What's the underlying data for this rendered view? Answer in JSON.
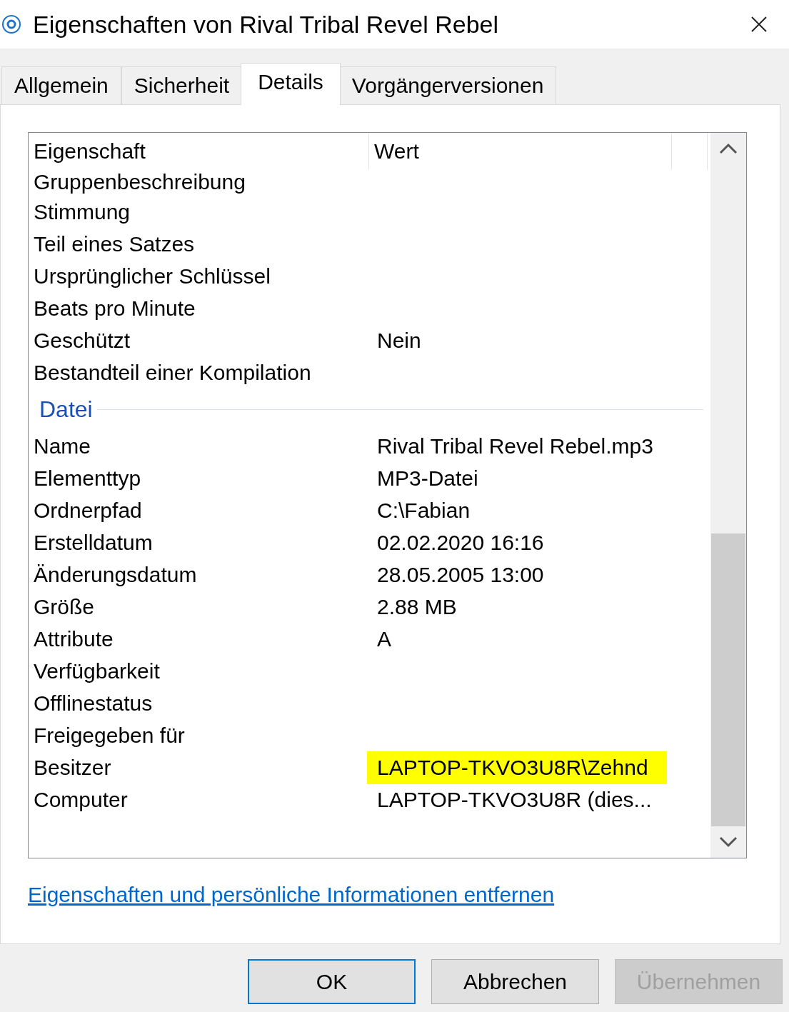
{
  "window": {
    "title": "Eigenschaften von Rival Tribal Revel Rebel"
  },
  "tabs": [
    {
      "label": "Allgemein",
      "selected": false
    },
    {
      "label": "Sicherheit",
      "selected": false
    },
    {
      "label": "Details",
      "selected": true
    },
    {
      "label": "Vorgängerversionen",
      "selected": false
    }
  ],
  "details": {
    "columns": [
      "Eigenschaft",
      "Wert"
    ],
    "rows": [
      {
        "kind": "property",
        "name": "Gruppenbeschreibung"
      },
      {
        "kind": "property",
        "name": "Stimmung"
      },
      {
        "kind": "property",
        "name": "Teil eines Satzes"
      },
      {
        "kind": "property",
        "name": "Ursprünglicher Schlüssel"
      },
      {
        "kind": "property",
        "name": "Beats pro Minute"
      },
      {
        "kind": "property",
        "name": "Geschützt",
        "value": "Nein"
      },
      {
        "kind": "property",
        "name": "Bestandteil einer Kompilation"
      },
      {
        "kind": "group",
        "name": "Datei"
      },
      {
        "kind": "property",
        "name": "Name",
        "value": "Rival Tribal Revel Rebel.mp3"
      },
      {
        "kind": "property",
        "name": "Elementtyp",
        "value": "MP3-Datei"
      },
      {
        "kind": "property",
        "name": "Ordnerpfad",
        "value": "C:\\Fabian"
      },
      {
        "kind": "property",
        "name": "Erstelldatum",
        "value": "02.02.2020 16:16"
      },
      {
        "kind": "property",
        "name": "Änderungsdatum",
        "value": "28.05.2005 13:00"
      },
      {
        "kind": "property",
        "name": "Größe",
        "value": "2.88 MB"
      },
      {
        "kind": "property",
        "name": "Attribute",
        "value": "A"
      },
      {
        "kind": "property",
        "name": "Verfügbarkeit"
      },
      {
        "kind": "property",
        "name": "Offlinestatus"
      },
      {
        "kind": "property",
        "name": "Freigegeben für"
      },
      {
        "kind": "property",
        "name": "Besitzer",
        "value": "LAPTOP-TKVO3U8R\\Zehnd",
        "highlighted": true
      },
      {
        "kind": "property",
        "name": "Computer",
        "value": "LAPTOP-TKVO3U8R (dies..."
      }
    ]
  },
  "link": "Eigenschaften und persönliche Informationen entfernen",
  "buttons": [
    {
      "label": "OK",
      "default": true,
      "disabled": false
    },
    {
      "label": "Abbrechen",
      "default": false,
      "disabled": false
    },
    {
      "label": "Übernehmen",
      "default": false,
      "disabled": true
    }
  ]
}
